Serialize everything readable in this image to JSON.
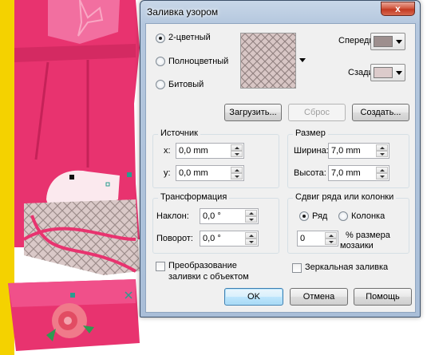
{
  "dialog": {
    "title": "Заливка узором",
    "close_glyph": "x",
    "pattern_type": {
      "options": [
        {
          "label": "2-цветный",
          "checked": true
        },
        {
          "label": "Полноцветный",
          "checked": false
        },
        {
          "label": "Битовый",
          "checked": false
        }
      ]
    },
    "colors": {
      "front_label": "Спереди:",
      "back_label": "Сзади:",
      "front_color": "#9d8f8e",
      "back_color": "#dccbcb"
    },
    "buttons": {
      "load": "Загрузить...",
      "reset": "Сброс",
      "create": "Создать...",
      "ok": "OK",
      "cancel": "Отмена",
      "help": "Помощь"
    },
    "origin": {
      "title": "Источник",
      "x_label": "x:",
      "x_value": "0,0 mm",
      "y_label": "y:",
      "y_value": "0,0 mm"
    },
    "size": {
      "title": "Размер",
      "width_label": "Ширина:",
      "width_value": "7,0 mm",
      "height_label": "Высота:",
      "height_value": "7,0 mm"
    },
    "transform": {
      "title": "Трансформация",
      "skew_label": "Наклон:",
      "skew_value": "0,0 °",
      "rotate_label": "Поворот:",
      "rotate_value": "0,0 °"
    },
    "offset": {
      "title": "Сдвиг ряда или колонки",
      "row_label": "Ряд",
      "column_label": "Колонка",
      "row_checked": true,
      "value": "0",
      "percent_label_1": "% размера",
      "percent_label_2": "мозаики"
    },
    "checkboxes": {
      "transform_with_object_1": "Преобразование",
      "transform_with_object_2": "заливки с объектом",
      "mirror_fill": "Зеркальная заливка"
    }
  }
}
